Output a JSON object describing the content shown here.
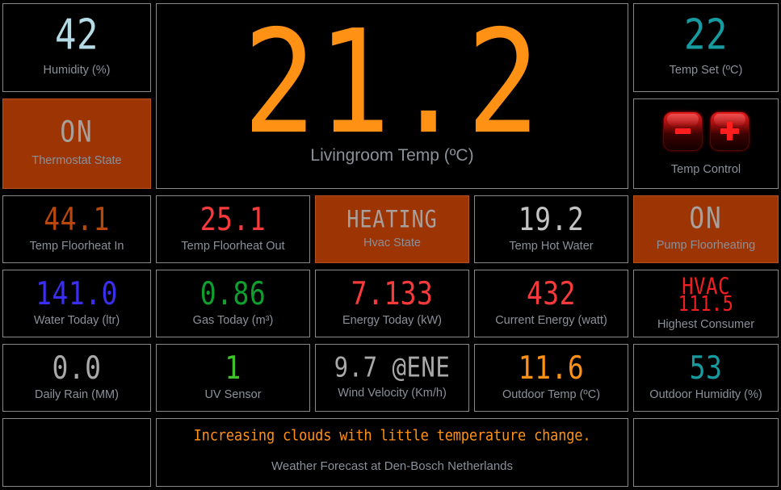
{
  "colors": {
    "background": "#000000",
    "tile_border": "#888888",
    "hot_background": "#9c3404",
    "label": "#8b9099",
    "light_blue": "#b5dbe6",
    "orange": "#ff9114",
    "teal": "#169ba0",
    "gray_value": "#a9a9a9",
    "rust_text": "#b8470c",
    "red": "#ff3333",
    "red_bright": "#f93a3a",
    "blue": "#3a2ef0",
    "green": "#0f9f2f",
    "green_bright": "#3fc22a",
    "state_text": "#a8a09c"
  },
  "tiles": {
    "humidity": {
      "value": "42",
      "label": "Humidity (%)"
    },
    "thermostat_state": {
      "value": "ON",
      "label": "Thermostat State"
    },
    "livingroom_temp": {
      "value": "21.2",
      "label": "Livingroom Temp (ºC)"
    },
    "temp_set": {
      "value": "22",
      "label": "Temp Set (ºC)"
    },
    "temp_control": {
      "label": "Temp Control",
      "decrease_label": "-",
      "increase_label": "+"
    },
    "temp_floorheat_in": {
      "value": "44.1",
      "label": "Temp Floorheat In"
    },
    "temp_floorheat_out": {
      "value": "25.1",
      "label": "Temp Floorheat Out"
    },
    "hvac_state": {
      "value": "HEATING",
      "label": "Hvac State"
    },
    "temp_hot_water": {
      "value": "19.2",
      "label": "Temp Hot Water"
    },
    "pump_floorheating": {
      "value": "ON",
      "label": "Pump Floorheating"
    },
    "water_today": {
      "value": "141.0",
      "label": "Water Today (ltr)"
    },
    "gas_today": {
      "value": "0.86",
      "label": "Gas Today (m³)"
    },
    "energy_today": {
      "value": "7.133",
      "label": "Energy Today (kW)"
    },
    "current_energy": {
      "value": "432",
      "label": "Current Energy (watt)"
    },
    "highest_consumer": {
      "value_name": "HVAC",
      "value_amount": "111.5",
      "label": "Highest Consumer"
    },
    "daily_rain": {
      "value": "0.0",
      "label": "Daily Rain (MM)"
    },
    "uv_sensor": {
      "value": "1",
      "label": "UV Sensor"
    },
    "wind_velocity": {
      "value": "9.7 @ENE",
      "label": "Wind Velocity (Km/h)"
    },
    "outdoor_temp": {
      "value": "11.6",
      "label": "Outdoor Temp (ºC)"
    },
    "outdoor_humidity": {
      "value": "53",
      "label": "Outdoor Humidity (%)"
    },
    "weather_forecast": {
      "value": "Increasing clouds with little temperature change.",
      "label": "Weather Forecast at Den-Bosch Netherlands"
    }
  }
}
